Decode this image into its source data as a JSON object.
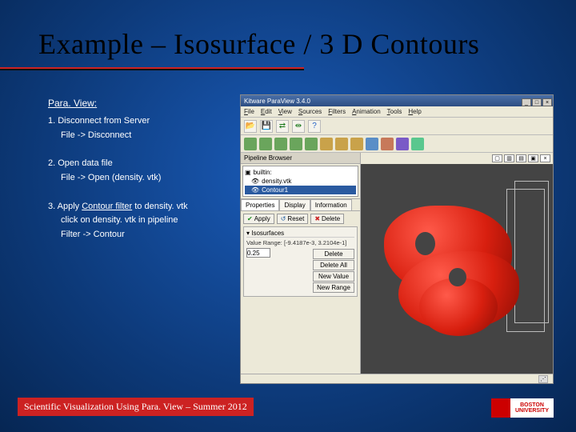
{
  "title": "Example – Isosurface / 3 D Contours",
  "instructions": {
    "heading": "Para. View:",
    "step1": "1. Disconnect from Server",
    "step1a": "File -> Disconnect",
    "step2": "2. Open data file",
    "step2a": "File -> Open (density. vtk)",
    "step3_prefix": "3. Apply ",
    "step3_link": "Contour filter",
    "step3_suffix": " to density. vtk",
    "step3a": "click on density. vtk in pipeline",
    "step3b": "Filter -> Contour"
  },
  "footer": "Scientific Visualization Using Para. View – Summer 2012",
  "bu": {
    "top": "BOSTON",
    "bottom": "UNIVERSITY"
  },
  "pv": {
    "title": "Kitware ParaView 3.4.0",
    "menu": [
      "File",
      "Edit",
      "View",
      "Sources",
      "Filters",
      "Animation",
      "Tools",
      "Help"
    ],
    "pipeline_label": "Pipeline Browser",
    "tree": {
      "root": "builtin:",
      "item1": "density.vtk",
      "item2": "Contour1"
    },
    "tabs": [
      "Properties",
      "Display",
      "Information"
    ],
    "apply": "Apply",
    "reset": "Reset",
    "delete": "Delete",
    "group": "Isosurfaces",
    "range": "Value Range: [-9.4187e-3, 3.2104e-1]",
    "val": "0.25",
    "rbtns": [
      "Delete",
      "Delete All",
      "New Value",
      "New Range"
    ]
  }
}
